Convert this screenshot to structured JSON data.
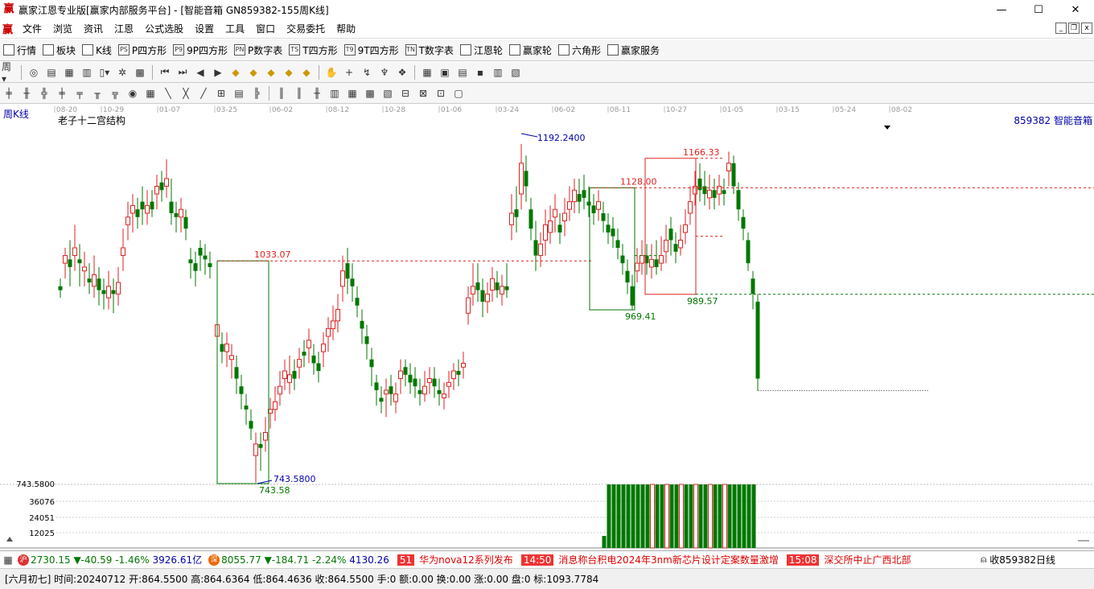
{
  "window": {
    "title": "赢家江恩专业版[赢家内部服务平台] - [智能音箱   GN859382-155周K线]",
    "logo": "赢",
    "controls": {
      "minimize": "—",
      "maximize": "☐",
      "close": "✕"
    }
  },
  "menu": {
    "items": [
      "文件",
      "浏览",
      "资讯",
      "江恩",
      "公式选股",
      "设置",
      "工具",
      "窗口",
      "交易委托",
      "帮助"
    ]
  },
  "toolbar1": {
    "items": [
      {
        "label": "行情",
        "icon": "table-icon"
      },
      {
        "label": "板块",
        "icon": "grid-icon"
      },
      {
        "label": "K线",
        "icon": "kline-icon"
      },
      {
        "label": "P四方形",
        "icon": "PS"
      },
      {
        "label": "9P四方形",
        "icon": "P9"
      },
      {
        "label": "P数字表",
        "icon": "PN"
      },
      {
        "label": "T四方形",
        "icon": "TS"
      },
      {
        "label": "9T四方形",
        "icon": "T9"
      },
      {
        "label": "T数字表",
        "icon": "TN"
      },
      {
        "label": "江恩轮",
        "icon": "wheel-icon"
      },
      {
        "label": "赢家轮",
        "icon": "wheel-icon"
      },
      {
        "label": "六角形",
        "icon": "hexagon-icon"
      },
      {
        "label": "赢家服务",
        "icon": "dollar-icon"
      }
    ]
  },
  "chart": {
    "period_label": "周K线",
    "indicator_name": "老子十二宫结构",
    "stock_label": "859382 智能音箱",
    "axis_dates": [
      "08-20",
      "10-29",
      "01-07",
      "03-25",
      "06-02",
      "08-12",
      "10-28",
      "01-06",
      "03-24",
      "06-02",
      "08-11",
      "10-27",
      "01-05",
      "03-15",
      "05-24",
      "08-02"
    ],
    "price_labels": {
      "high": "1192.2400",
      "low": "743.5800",
      "low_short": "743.58",
      "low_axis": "743.5800",
      "l1033": "1033.07",
      "l1128": "1128.00",
      "l1166": "1166.33",
      "l969": "969.41",
      "l989": "989.57"
    },
    "volume_axis": [
      "36076",
      "24051",
      "12025"
    ]
  },
  "status": {
    "index1": {
      "badge": "沪",
      "value": "2730.15",
      "change": "▼-40.59",
      "pct": "-1.46%",
      "amount": "3926.61亿"
    },
    "index2": {
      "badge": "深",
      "value": "8055.77",
      "change": "▼-184.71",
      "pct": "-2.24%",
      "amount": "4130.26"
    },
    "news": [
      {
        "time": "51",
        "text": "华为nova12系列发布"
      },
      {
        "time": "14:50",
        "text": "消息称台积电2024年3nm新芯片设计定案数量激增"
      },
      {
        "time": "15:08",
        "text": "深交所中止广西北部"
      }
    ],
    "right": "收859382日线"
  },
  "bar_info": "[六月初七] 时间:20240712 开:864.5500 高:864.6364 低:864.4636 收:864.5500 手:0 额:0.00 换:0.00 涨:0.00 盘:0 标:1093.7784"
}
